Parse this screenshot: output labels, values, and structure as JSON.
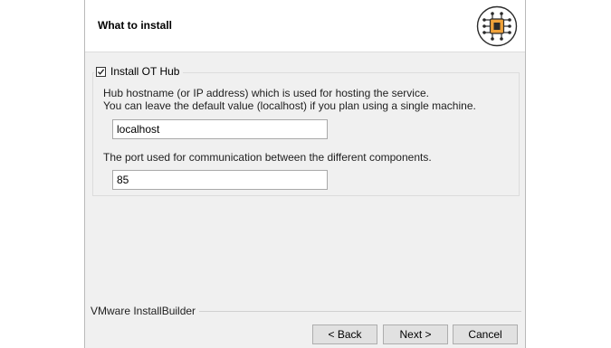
{
  "header": {
    "title": "What to install",
    "logo_icon": "circuit-chip-icon"
  },
  "install_group": {
    "checkbox_label": "Install OT Hub",
    "checked": true,
    "hostname_description_line1": "Hub hostname (or IP address) which is used for hosting the service.",
    "hostname_description_line2": "You can leave the default value (localhost) if you plan using a single machine.",
    "hostname_value": "localhost",
    "port_description": "The port used for communication between the different components.",
    "port_value": "85"
  },
  "footer": {
    "brand": "VMware InstallBuilder",
    "back_label": "< Back",
    "next_label": "Next >",
    "cancel_label": "Cancel"
  },
  "colors": {
    "chip_orange": "#f0a23a",
    "chip_dark": "#2b2b2b",
    "window_bg": "#f0f0f0"
  }
}
